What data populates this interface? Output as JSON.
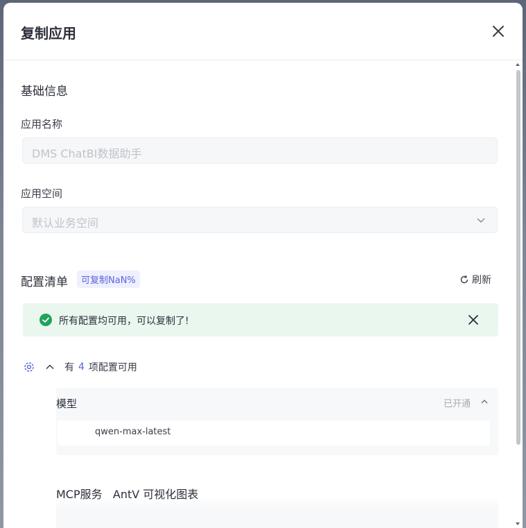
{
  "dialog": {
    "title": "复制应用"
  },
  "basic_info": {
    "section_title": "基础信息",
    "app_name": {
      "label": "应用名称",
      "value": "DMS ChatBI数据助手"
    },
    "app_space": {
      "label": "应用空间",
      "value": "默认业务空间"
    }
  },
  "config_list": {
    "title": "配置清单",
    "badge": "可复制NaN%",
    "refresh_label": "刷新",
    "alert": {
      "text": "所有配置均可用，可以复制了!",
      "color": "#20a35a"
    },
    "group": {
      "prefix": "有",
      "count": "4",
      "suffix": "项配置可用"
    },
    "items": [
      {
        "title": "模型",
        "status": "已开通",
        "entries": [
          "qwen-max-latest"
        ]
      },
      {
        "title": "MCP服务   AntV 可视化图表"
      }
    ]
  },
  "colors": {
    "accent": "#5a62e0",
    "success": "#20a35a"
  }
}
